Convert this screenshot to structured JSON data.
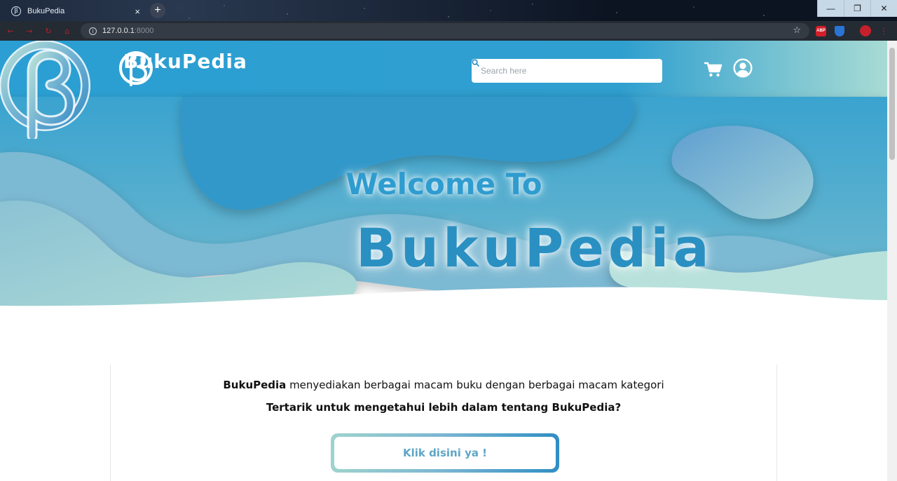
{
  "browser": {
    "tab_title": "BukuPedia",
    "tab_close": "×",
    "new_tab": "+",
    "url_host": "127.0.0.1",
    "url_port": ":8000",
    "window_controls": {
      "minimize": "—",
      "restore": "❐",
      "close": "✕"
    },
    "extensions": [
      "abp",
      "shield",
      "profile"
    ],
    "abp_label": "ABP"
  },
  "navbar": {
    "brand_name": "BukuPedia",
    "search_placeholder": "Search here",
    "icons": [
      "search-icon",
      "cart-icon",
      "user-icon"
    ]
  },
  "hero": {
    "welcome": "Welcome To",
    "brand_name": "BukuPedia"
  },
  "intro": {
    "brand_bold": "BukuPedia",
    "line1_rest": " menyediakan berbagai macam buku dengan berbagai macam kategori",
    "line2": "Tertarik untuk mengetahui lebih dalam tentang BukuPedia?",
    "cta_label": "Klik disini ya !"
  },
  "colors": {
    "navbar": "#2a9bcf",
    "accent": "#2a90c2",
    "wave_light": "#a6d8d3"
  }
}
